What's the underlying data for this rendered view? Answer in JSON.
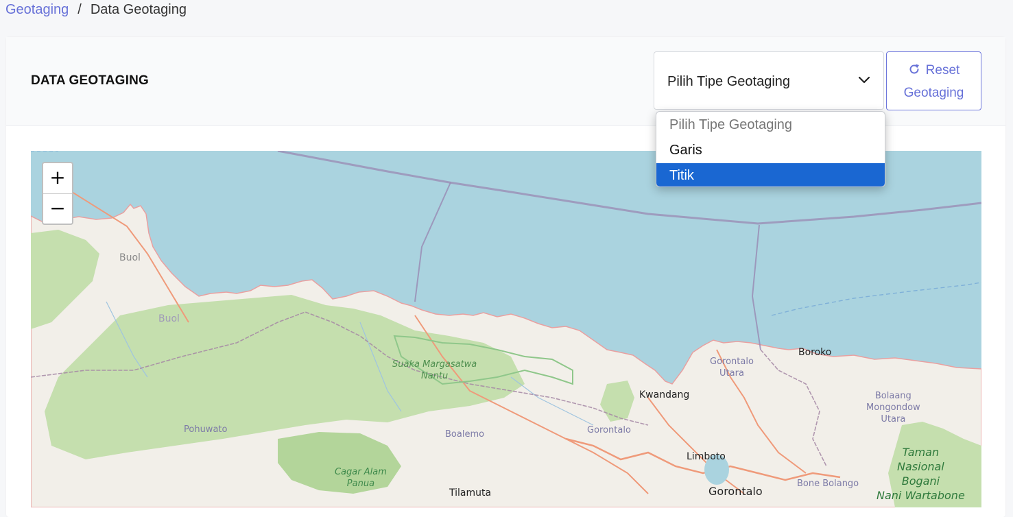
{
  "breadcrumb": {
    "parent": "Geotaging",
    "separator": "/",
    "current": "Data Geotaging"
  },
  "card": {
    "title": "DATA GEOTAGING"
  },
  "select": {
    "value": "Pilih Tipe Geotaging",
    "options": [
      "Pilih Tipe Geotaging",
      "Garis",
      "Titik"
    ],
    "highlighted": "Titik"
  },
  "reset": {
    "line1": "Reset",
    "line2": "Geotaging"
  },
  "zoom": {
    "in": "+",
    "out": "−"
  },
  "map": {
    "labels": {
      "buol_a": "Buol",
      "buol_b": "Buol",
      "suaka": [
        "Suaka Margasatwa",
        "Nantu"
      ],
      "gorontalo_utara": [
        "Gorontalo",
        "Utara"
      ],
      "boroko": "Boroko",
      "kwandang": "Kwandang",
      "bolaang": [
        "Bolaang",
        "Mongondow",
        "Utara"
      ],
      "pohuwato": "Pohuwato",
      "boalemo": "Boalemo",
      "gorontalo_reg": "Gorontalo",
      "limboto": "Limboto",
      "taman": [
        "Taman",
        "Nasional",
        "Bogani",
        "Nani Wartabone"
      ],
      "cagar": [
        "Cagar Alam",
        "Panua"
      ],
      "bone_bolango": "Bone Bolango",
      "tilamuta": "Tilamuta",
      "gorontalo_city": "Gorontalo"
    }
  },
  "colors": {
    "accent": "#6771d8",
    "highlight": "#1a67d2",
    "water": "#aad3df",
    "land": "#f2efe9",
    "forest": "#c5dfae"
  }
}
